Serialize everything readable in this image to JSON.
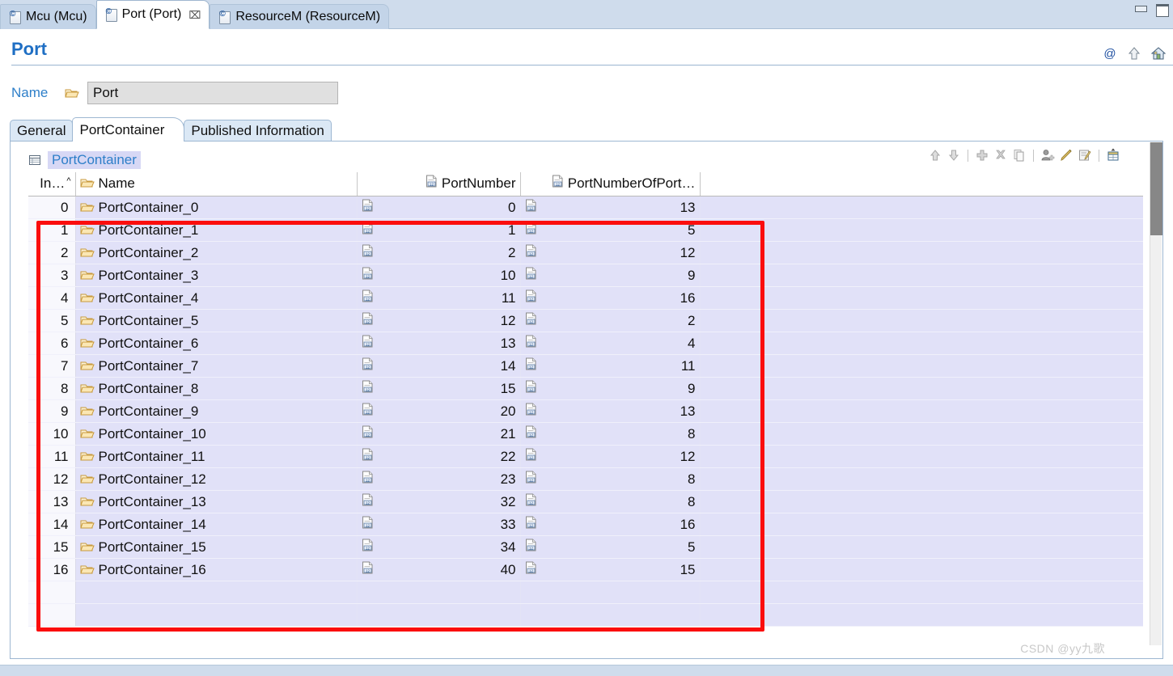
{
  "window": {
    "minimize_label": "Minimize",
    "maximize_label": "Restore"
  },
  "editor_tabs": [
    {
      "label": "Mcu (Mcu)",
      "active": false,
      "closable": false
    },
    {
      "label": "Port (Port)",
      "active": true,
      "closable": true,
      "close_glyph": "⌧"
    },
    {
      "label": "ResourceM (ResourceM)",
      "active": false,
      "closable": false
    }
  ],
  "form": {
    "title": "Port",
    "header_icons": [
      "at-icon",
      "up-arrow-icon",
      "home-icon"
    ],
    "name_label": "Name",
    "name_value": "Port"
  },
  "section_tabs": [
    {
      "label": "General",
      "active": false
    },
    {
      "label": "PortContainer",
      "active": true
    },
    {
      "label": "Published Information",
      "active": false
    }
  ],
  "table_section": {
    "title": "PortContainer",
    "toolbar": [
      {
        "name": "move-up-icon",
        "label": "Move Up"
      },
      {
        "name": "move-down-icon",
        "label": "Move Down"
      },
      {
        "name": "separator-1",
        "label": ""
      },
      {
        "name": "add-icon",
        "label": "Add"
      },
      {
        "name": "delete-icon",
        "label": "Delete"
      },
      {
        "name": "copy-icon",
        "label": "Copy"
      },
      {
        "name": "separator-2",
        "label": ""
      },
      {
        "name": "add-user-icon",
        "label": "Add Reference"
      },
      {
        "name": "edit-pencil-icon",
        "label": "Edit"
      },
      {
        "name": "edit-note-icon",
        "label": "Edit Properties"
      },
      {
        "name": "separator-3",
        "label": ""
      },
      {
        "name": "export-table-icon",
        "label": "Export"
      }
    ],
    "columns": [
      {
        "key": "index",
        "label": "In…",
        "align": "right",
        "icon": null,
        "sorted": true
      },
      {
        "key": "name",
        "label": "Name",
        "align": "left",
        "icon": "folder-icon"
      },
      {
        "key": "port_number",
        "label": "PortNumber",
        "align": "right",
        "icon": "number-doc-icon"
      },
      {
        "key": "port_number_of_port",
        "label": "PortNumberOfPort…",
        "align": "right",
        "icon": "number-doc-icon"
      },
      {
        "key": "spacer",
        "label": "",
        "align": "left",
        "icon": null
      }
    ],
    "rows": [
      {
        "index": "0",
        "name": "PortContainer_0",
        "port_number": "0",
        "port_number_of_port": "13"
      },
      {
        "index": "1",
        "name": "PortContainer_1",
        "port_number": "1",
        "port_number_of_port": "5"
      },
      {
        "index": "2",
        "name": "PortContainer_2",
        "port_number": "2",
        "port_number_of_port": "12"
      },
      {
        "index": "3",
        "name": "PortContainer_3",
        "port_number": "10",
        "port_number_of_port": "9"
      },
      {
        "index": "4",
        "name": "PortContainer_4",
        "port_number": "11",
        "port_number_of_port": "16"
      },
      {
        "index": "5",
        "name": "PortContainer_5",
        "port_number": "12",
        "port_number_of_port": "2"
      },
      {
        "index": "6",
        "name": "PortContainer_6",
        "port_number": "13",
        "port_number_of_port": "4"
      },
      {
        "index": "7",
        "name": "PortContainer_7",
        "port_number": "14",
        "port_number_of_port": "11"
      },
      {
        "index": "8",
        "name": "PortContainer_8",
        "port_number": "15",
        "port_number_of_port": "9"
      },
      {
        "index": "9",
        "name": "PortContainer_9",
        "port_number": "20",
        "port_number_of_port": "13"
      },
      {
        "index": "10",
        "name": "PortContainer_10",
        "port_number": "21",
        "port_number_of_port": "8"
      },
      {
        "index": "11",
        "name": "PortContainer_11",
        "port_number": "22",
        "port_number_of_port": "12"
      },
      {
        "index": "12",
        "name": "PortContainer_12",
        "port_number": "23",
        "port_number_of_port": "8"
      },
      {
        "index": "13",
        "name": "PortContainer_13",
        "port_number": "32",
        "port_number_of_port": "8"
      },
      {
        "index": "14",
        "name": "PortContainer_14",
        "port_number": "33",
        "port_number_of_port": "16"
      },
      {
        "index": "15",
        "name": "PortContainer_15",
        "port_number": "34",
        "port_number_of_port": "5"
      },
      {
        "index": "16",
        "name": "PortContainer_16",
        "port_number": "40",
        "port_number_of_port": "15"
      }
    ]
  },
  "annotation": {
    "highlight_color": "#fb0d0d"
  },
  "watermark": "CSDN @yy九歌"
}
